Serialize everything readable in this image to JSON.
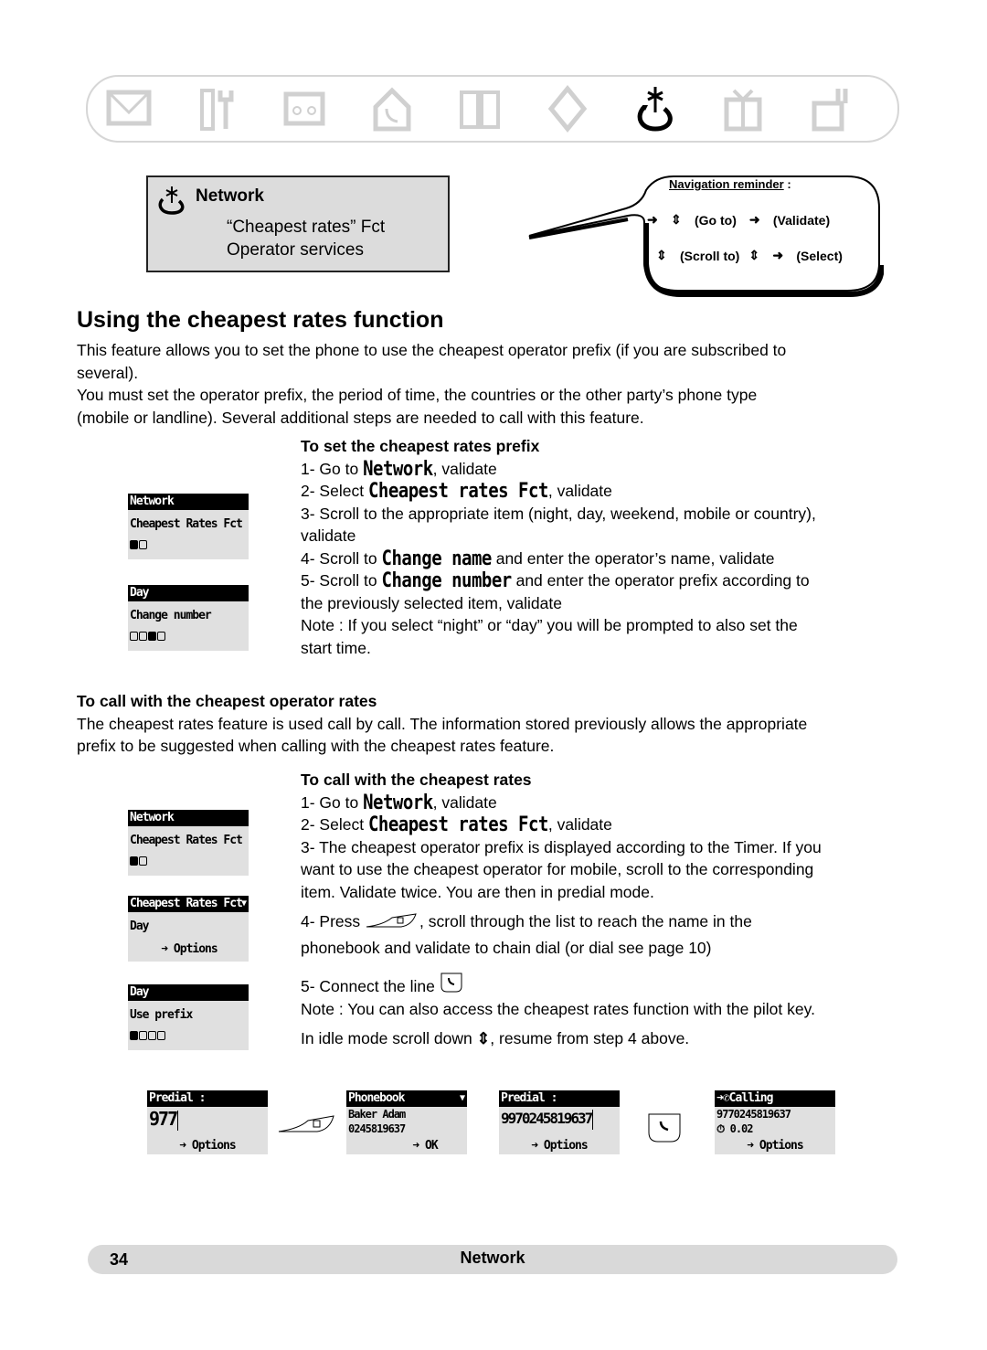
{
  "menu_bar": {
    "icons": [
      {
        "name": "messages-icon",
        "active": false
      },
      {
        "name": "tools-icon",
        "active": false
      },
      {
        "name": "answering-machine-icon",
        "active": false
      },
      {
        "name": "home-phone-icon",
        "active": false
      },
      {
        "name": "phonebook-icon",
        "active": false
      },
      {
        "name": "calls-icon",
        "active": false
      },
      {
        "name": "network-icon",
        "active": true
      },
      {
        "name": "gift-icon",
        "active": false
      },
      {
        "name": "handset-icon",
        "active": false
      }
    ]
  },
  "network_box": {
    "title": "Network",
    "items": [
      "“Cheapest rates” Fct",
      "Operator services"
    ]
  },
  "nav_reminder": {
    "title": "Navigation reminder",
    "title_suffix": " :",
    "go_to": "(Go to)",
    "validate": "(Validate)",
    "scroll_to": "(Scroll to)",
    "select": "(Select)"
  },
  "heading": "Using the cheapest rates function",
  "intro": {
    "p1_line1": "This feature allows you to set the phone to use the cheapest operator prefix (if you are subscribed to",
    "p1_line2": "several).",
    "p2_line1": "You must set the operator prefix, the period of time, the countries or the other party’s phone type",
    "p2_line2": "(mobile or landline). Several additional steps are needed to call with this feature."
  },
  "set_prefix": {
    "title": "To set the cheapest rates prefix",
    "s1_pre": "1- Go to ",
    "s1_lcd": "Network",
    "s1_post": ", validate",
    "s2_pre": "2- Select ",
    "s2_lcd": "Cheapest rates Fct",
    "s2_post": ", validate",
    "s3_line1": "3- Scroll to the appropriate item (night, day, weekend, mobile or country),",
    "s3_line2": "validate",
    "s4_pre": "4- Scroll to ",
    "s4_lcd": "Change name",
    "s4_post": " and enter the operator’s name, validate",
    "s5_pre": "5- Scroll to ",
    "s5_lcd": "Change number",
    "s5_post": " and enter the operator prefix according to",
    "s5_line2": "the previously selected item, validate",
    "note_line1": "Note : If you select “night” or “day” you will be prompted to also set the",
    "note_line2": "start time."
  },
  "screens_set": [
    {
      "header": "Network",
      "row": "Cheapest Rates Fct",
      "dots": [
        true,
        false
      ]
    },
    {
      "header": "Day",
      "row": "Change number",
      "dots": [
        false,
        false,
        true,
        false
      ]
    }
  ],
  "call_operator": {
    "title": "To call with the cheapest operator rates",
    "line1": "The cheapest rates feature is used call by call. The information stored previously allows the appropriate",
    "line2": "prefix to be suggested when calling with the cheapest rates feature."
  },
  "call_cheapest": {
    "title": "To call with the cheapest rates",
    "s1_pre": "1- Go to ",
    "s1_lcd": "Network",
    "s1_post": ", validate",
    "s2_pre": "2- Select ",
    "s2_lcd": "Cheapest rates Fct",
    "s2_post": ", validate",
    "s3_line1": "3- The cheapest operator prefix is displayed according to the Timer. If you",
    "s3_line2": "want to use the cheapest operator for mobile, scroll to the corresponding",
    "s3_line3": "item. Validate twice. You are then in predial mode.",
    "s4_pre": "4- Press ",
    "s4_post": ", scroll through the list to reach the name in the",
    "s4_line2": "phonebook and validate to chain dial (or dial see page 10)",
    "s5": "5- Connect the line ",
    "note_line1": "Note : You can also access the cheapest rates function with the pilot key.",
    "note_line2_pre": "In idle mode scroll down ",
    "note_line2_post": ", resume from step 4 above."
  },
  "screens_call": [
    {
      "header": "Network",
      "row": "Cheapest Rates Fct",
      "dots": [
        true,
        false
      ]
    },
    {
      "header": "Cheapest Rates Fct",
      "row": "Day",
      "softkey": "Options"
    },
    {
      "header": "Day",
      "row": "Use prefix",
      "dots": [
        true,
        false,
        false,
        false
      ]
    }
  ],
  "bottom_screens": {
    "predial1": {
      "header": "Predial :",
      "number": "977",
      "softkey": "Options"
    },
    "phonebook": {
      "header": "Phonebook",
      "name": "Baker Adam",
      "number": "0245819637",
      "softkey": "OK"
    },
    "predial2": {
      "header": "Predial :",
      "number": "9970245819637",
      "softkey": "Options"
    },
    "calling": {
      "header": "Calling",
      "number": "9770245819637",
      "timer": "0.02",
      "softkey": "Options"
    }
  },
  "footer": {
    "page": "34",
    "section": "Network"
  }
}
